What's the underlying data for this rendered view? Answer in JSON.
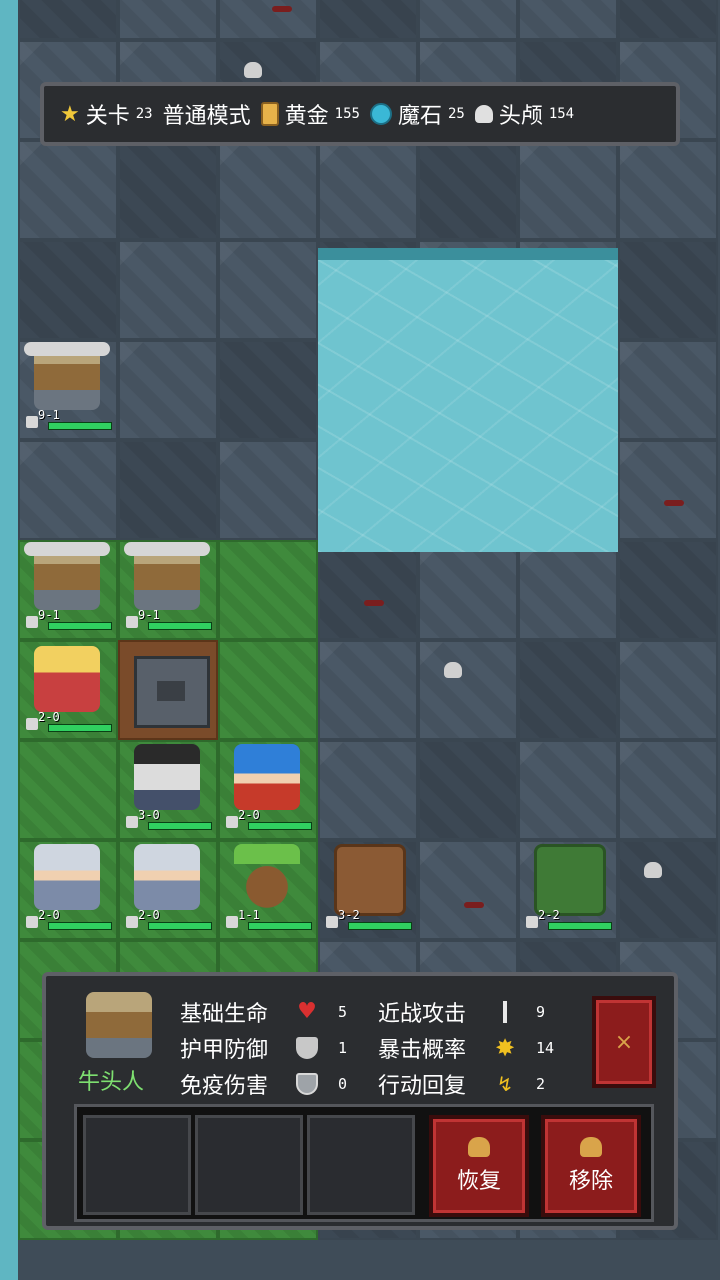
{
  "hud": {
    "stage_label": "关卡",
    "stage_value": "23",
    "mode": "普通模式",
    "gold_label": "黄金",
    "gold_value": "155",
    "magic_stone_label": "魔石",
    "magic_stone_value": "25",
    "skull_label": "头颅",
    "skull_value": "154"
  },
  "units": [
    {
      "name": "minotaur",
      "level": "9-1"
    },
    {
      "name": "minotaur",
      "level": "9-1"
    },
    {
      "name": "minotaur",
      "level": "9-1"
    },
    {
      "name": "bard",
      "level": "2-0"
    },
    {
      "name": "wizard",
      "level": "3-0"
    },
    {
      "name": "archer",
      "level": "2-0"
    },
    {
      "name": "valkyrie",
      "level": "2-0"
    },
    {
      "name": "valkyrie",
      "level": "2-0"
    },
    {
      "name": "sprout",
      "level": "1-1"
    },
    {
      "name": "golem",
      "level": "3-2"
    },
    {
      "name": "treant",
      "level": "2-2"
    }
  ],
  "info_panel": {
    "unit_name": "牛头人",
    "stats": {
      "base_hp_label": "基础生命",
      "base_hp_value": "5",
      "armor_label": "护甲防御",
      "armor_value": "1",
      "immune_label": "免疫伤害",
      "immune_value": "0",
      "melee_label": "近战攻击",
      "melee_value": "9",
      "crit_label": "暴击概率",
      "crit_value": "14",
      "regen_label": "行动回复",
      "regen_value": "2"
    },
    "close_label": "×",
    "restore_label": "恢复",
    "remove_label": "移除"
  },
  "colors": {
    "panel_bg": "#2b2d30",
    "button_red": "#8c1c1c",
    "name_green": "#7ee070",
    "water": "#6fc4cf",
    "grass": "#3f8a3c"
  }
}
